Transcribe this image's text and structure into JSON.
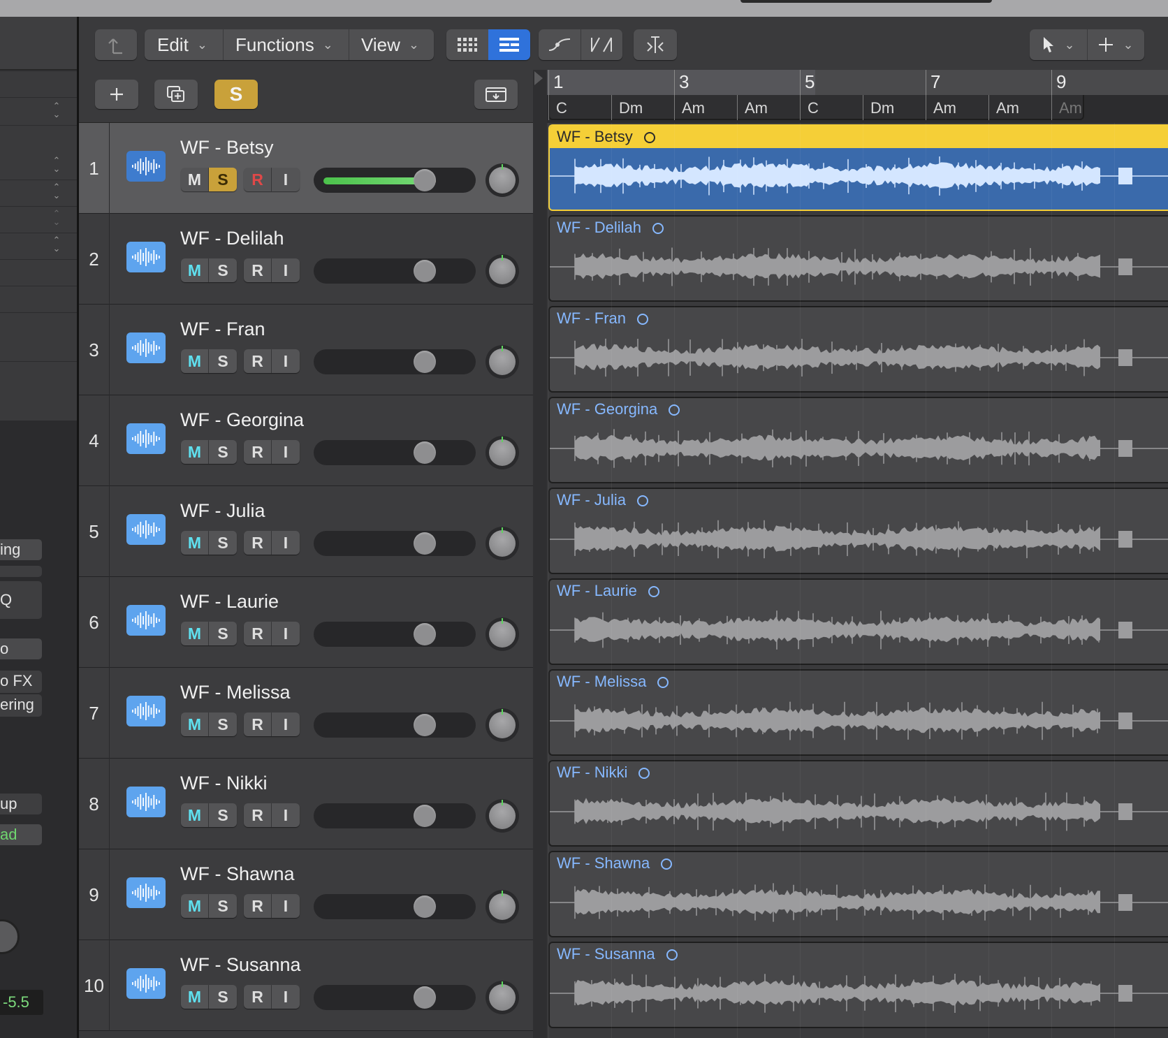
{
  "toolbar": {
    "menus": [
      {
        "label": "Edit"
      },
      {
        "label": "Functions"
      },
      {
        "label": "View"
      }
    ]
  },
  "track_list_header": {
    "global_solo_label": "S"
  },
  "inspector": {
    "partial_labels": [
      "ing",
      "Q",
      "o",
      "o FX",
      "ering",
      "up",
      "ad"
    ],
    "volume_value": "-5.5"
  },
  "ruler": {
    "bars": [
      "1",
      "3",
      "5",
      "7",
      "9"
    ],
    "chords": [
      "C",
      "Dm",
      "Am",
      "Am",
      "C",
      "Dm",
      "Am",
      "Am",
      "Am"
    ]
  },
  "tracks": [
    {
      "number": "1",
      "name": "WF - Betsy",
      "selected": true,
      "volume_level": 0.72,
      "solo": true,
      "record_armed": true
    },
    {
      "number": "2",
      "name": "WF - Delilah",
      "selected": false,
      "volume_level": 0.72
    },
    {
      "number": "3",
      "name": "WF - Fran",
      "selected": false,
      "volume_level": 0.72
    },
    {
      "number": "4",
      "name": "WF - Georgina",
      "selected": false,
      "volume_level": 0.72
    },
    {
      "number": "5",
      "name": "WF - Julia",
      "selected": false,
      "volume_level": 0.72
    },
    {
      "number": "6",
      "name": "WF - Laurie",
      "selected": false,
      "volume_level": 0.72
    },
    {
      "number": "7",
      "name": "WF - Melissa",
      "selected": false,
      "volume_level": 0.72
    },
    {
      "number": "8",
      "name": "WF - Nikki",
      "selected": false,
      "volume_level": 0.72
    },
    {
      "number": "9",
      "name": "WF - Shawna",
      "selected": false,
      "volume_level": 0.72
    },
    {
      "number": "10",
      "name": "WF - Susanna",
      "selected": false,
      "volume_level": 0.72
    }
  ],
  "track_button_labels": {
    "mute": "M",
    "solo": "S",
    "record": "R",
    "input": "I"
  },
  "colors": {
    "region_selected_header": "#f5cf37",
    "region_selected_body": "#3a6aab",
    "region_name": "#86b8ff",
    "mute_active": "#5fe0ef",
    "solo_active": "#c9a13a",
    "record_active": "#e04848",
    "track_icon": "#5ea4ee"
  }
}
